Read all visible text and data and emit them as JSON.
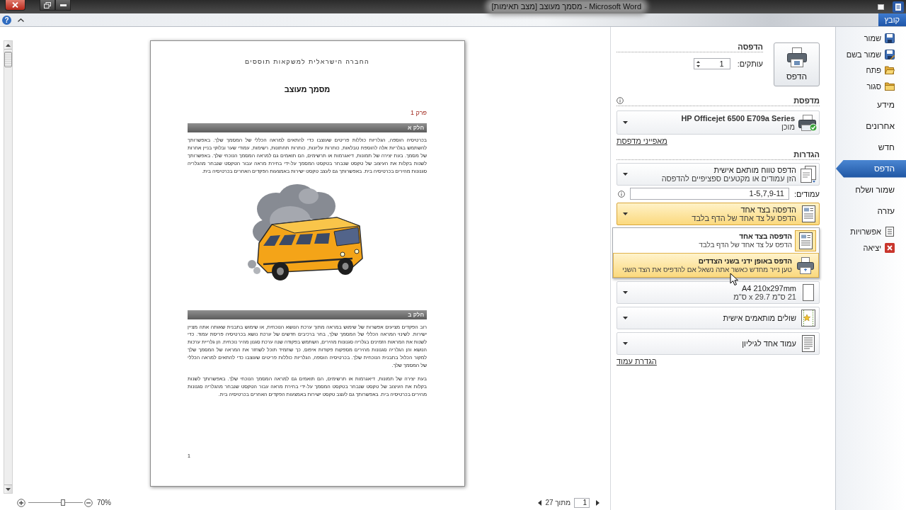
{
  "window": {
    "title": "מסמך מעוצב [מצב תאימות] - Microsoft Word"
  },
  "ribbon": {
    "help": "?",
    "file_tab": "קובץ"
  },
  "nav": {
    "items": [
      {
        "label": "שמור",
        "kind": "save",
        "selected": false
      },
      {
        "label": "שמור בשם",
        "kind": "save_as",
        "selected": false
      },
      {
        "label": "פתח",
        "kind": "open",
        "selected": false
      },
      {
        "label": "סגור",
        "kind": "close",
        "selected": false
      },
      {
        "label": "מידע",
        "kind": "page",
        "selected": false
      },
      {
        "label": "אחרונים",
        "kind": "page",
        "selected": false
      },
      {
        "label": "חדש",
        "kind": "page",
        "selected": false
      },
      {
        "label": "הדפס",
        "kind": "page",
        "selected": true
      },
      {
        "label": "שמור ושלח",
        "kind": "page",
        "selected": false
      },
      {
        "label": "עזרה",
        "kind": "page",
        "selected": false
      },
      {
        "label": "אפשרויות",
        "kind": "options",
        "selected": false
      },
      {
        "label": "יציאה",
        "kind": "exit",
        "selected": false
      }
    ]
  },
  "print": {
    "button": "הדפס",
    "heading": "הדפסה",
    "copies_label": "עותקים:",
    "copies": "1"
  },
  "printer": {
    "heading": "מדפסת",
    "name": "HP Officejet 6500 E709a Series",
    "status": "מוכן",
    "properties_link": "מאפייני מדפסת"
  },
  "settings": {
    "heading": "הגדרות",
    "items": [
      {
        "kind": "range",
        "title": "הדפס טווח מותאם אישית",
        "subtitle": "הזן עמודים או מקטעים ספציפיים להדפסה",
        "expanded": false
      },
      {
        "kind": "pages",
        "label": "עמודים:",
        "value": "1-5,7,9-11"
      },
      {
        "kind": "sides",
        "title": "הדפסה בצד אחד",
        "subtitle": "הדפס על צד אחד של הדף בלבד",
        "expanded": true,
        "options": [
          {
            "kind": "one_sided",
            "title": "הדפסה בצד אחד",
            "subtitle": "הדפס על צד אחד של הדף בלבד",
            "selected": true,
            "hovered": false
          },
          {
            "kind": "manual_duplex",
            "title": "הדפס באופן ידני בשני הצדדים",
            "subtitle": "טען נייר מחדש כאשר אתה נשאל אם להדפיס את הצד השני",
            "selected": false,
            "hovered": true
          }
        ]
      },
      {
        "kind": "paper",
        "title": "A4 210x297mm",
        "subtitle": "21 ס\"מ x 29.7 ס\"מ",
        "expanded": false
      },
      {
        "kind": "margins",
        "title": "שולים מותאמים אישית",
        "expanded": false
      },
      {
        "kind": "per_sheet",
        "title": "עמוד אחד לגיליון",
        "expanded": false
      }
    ],
    "page_setup_link": "הגדרת עמוד"
  },
  "document": {
    "org_name": "החברה הישראלית למשקאות תוססים",
    "title": "מסמך מעוצב",
    "chapter": "פרק 1",
    "blocks": [
      {
        "kind": "heading",
        "text": "חלק א"
      },
      {
        "kind": "paragraph",
        "text": "בכרטיסיה הוספה, הגלריות כוללות פריטים שעוצבו כדי להתאים למראה הכללי של המסמך שלך. באפשרותך להשתמש בגלריות אלה להוספת טבלאות, כותרות עליונות, כותרות תחתונות, רשימות, עמודי שער ובלוקי בניין אחרות של מסמך. בעת יצירה של תמונות, דיאגרמות או תרשימים, הם תואמים גם למראה המסמך הנוכחי שלך. באפשרותך לשנות בקלות את העיצוב של טקסט שנבחר בטקסט המסמך על-ידי בחירת מראה עבור הטקסט שנבחר מהגלריה סגנונות מהירים בכרטיסיה בית. באפשרותך גם לעצב טקסט ישירות באמצעות הפקדים האחרים בכרטיסיה בית."
      },
      {
        "kind": "image"
      },
      {
        "kind": "heading",
        "text": "חלק ב"
      },
      {
        "kind": "paragraph",
        "text": "רוב הפקדים מציעים אפשרות של שימוש במראה מתוך ערכת הנושא הנוכחית, או שימוש בתבנית שאותה אתה מציין ישירות. לשינוי המראה הכללי של המסמך שלך, בחר ברכיבים חדשים של ערכת נושא בכרטיסיה פריסת עמוד. כדי לשנות את המראות הזמינים בגלריה סגנונות מהירים, השתמש בפקודה שנה ערכת סגנון מהיר נוכחית. הן גלריית ערכות הנושא והן הגלריה סגנונות מהירים מספקות פקודות איפוס, כך שתמיד תוכל לשחזר את המראה של המסמך שלך למקור הכלול בתבנית הנוכחית שלך. בכרטיסיה הוספה, הגלריות כוללות פריטים שעוצבו כדי להתאים למראה הכללי של המסמך שלך."
      },
      {
        "kind": "paragraph",
        "text": "בעת יצירה של תמונות, דיאגרמות או תרשימים, הם תואמים גם למראה המסמך הנוכחי שלך. באפשרותך לשנות בקלות את העיצוב של טקסט שנבחר בטקסט המסמך על-ידי בחירת מראה עבור הטקסט שנבחר מהגלריה סגנונות מהירים בכרטיסיה בית. באפשרותך גם לעצב טקסט ישירות באמצעות הפקדים האחרים בכרטיסיה בית."
      }
    ],
    "page_number": "1"
  },
  "status_bar": {
    "zoom": {
      "level": 0.64,
      "label": "70%"
    },
    "page": {
      "current": "1",
      "of_total": "מתוך 27"
    }
  }
}
